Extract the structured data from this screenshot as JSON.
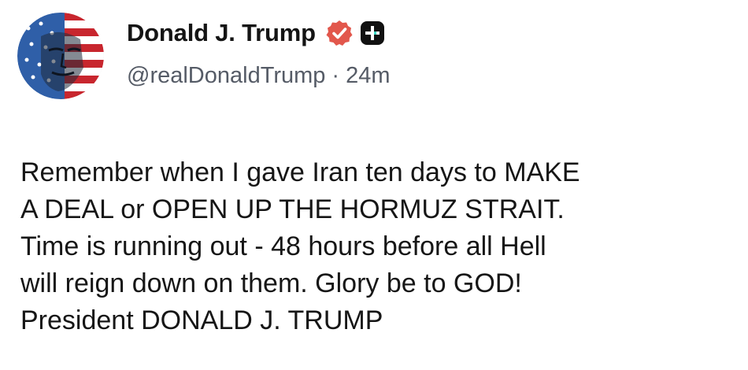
{
  "author": {
    "display_name": "Donald J. Trump",
    "handle": "@realDonaldTrump",
    "separator": "·",
    "timestamp": "24m",
    "avatar_icon": "american-flag-portrait-avatar",
    "verified_icon": "verified-badge-icon",
    "verified_color": "#e2574c",
    "plus_icon": "truth-social-plus-icon"
  },
  "post": {
    "lines": [
      "Remember when I gave Iran ten days to MAKE",
      "A DEAL or OPEN UP THE HORMUZ STRAIT.",
      "Time is running out - 48 hours before all Hell",
      "will reign down on them. Glory be to GOD!",
      "President DONALD J. TRUMP"
    ]
  }
}
